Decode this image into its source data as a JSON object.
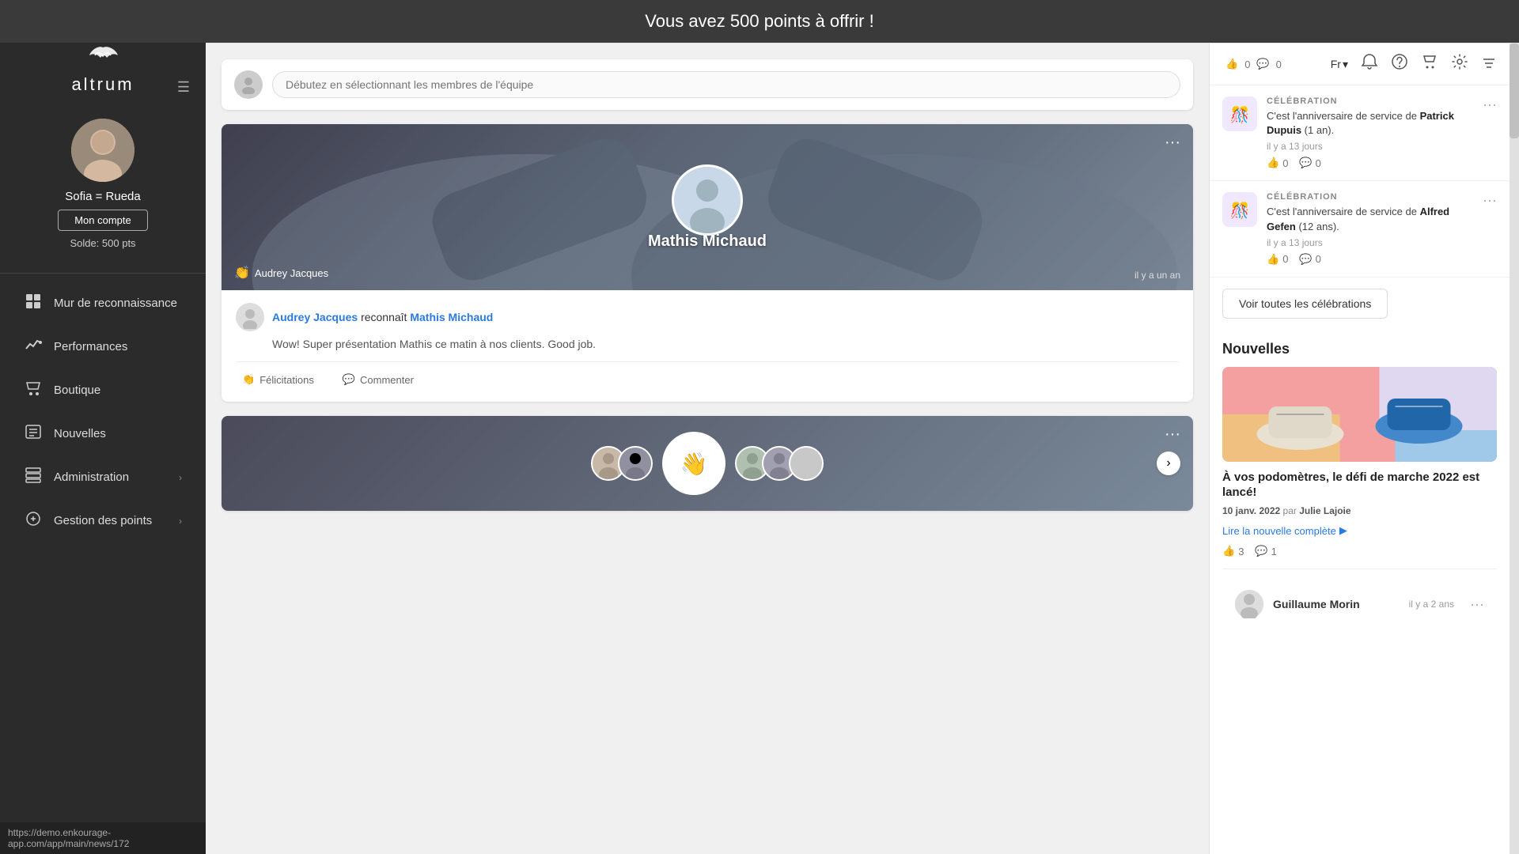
{
  "banner": {
    "text": "Vous avez 500 points à offrir !"
  },
  "sidebar": {
    "logo": {
      "bird": "≋",
      "name": "altrum"
    },
    "user": {
      "name": "Sofia = Rueda",
      "account_btn": "Mon compte",
      "balance": "Solde: 500 pts",
      "avatar_emoji": "👩"
    },
    "nav_items": [
      {
        "id": "mur",
        "label": "Mur de reconnaissance",
        "icon": "🏠"
      },
      {
        "id": "performances",
        "label": "Performances",
        "icon": "📈"
      },
      {
        "id": "boutique",
        "label": "Boutique",
        "icon": "🛍"
      },
      {
        "id": "nouvelles",
        "label": "Nouvelles",
        "icon": "📋"
      },
      {
        "id": "administration",
        "label": "Administration",
        "icon": "🗂",
        "arrow": "›"
      },
      {
        "id": "gestion",
        "label": "Gestion des points",
        "icon": "💰",
        "arrow": "›"
      }
    ]
  },
  "header": {
    "lang": "Fr",
    "lang_arrow": "▾",
    "icons": [
      "bell",
      "question",
      "shop",
      "gear"
    ]
  },
  "team_selector": {
    "placeholder": "Débutez en sélectionnant les membres de l'équipe"
  },
  "post1": {
    "dots": "···",
    "person_name": "Mathis Michaud",
    "sender": "Audrey Jacques",
    "time": "il y a un an",
    "author": "Audrey Jacques",
    "recognizes": "reconnaît",
    "target": "Mathis Michaud",
    "message": "Wow! Super présentation Mathis ce matin à nos clients. Good job.",
    "action_clap": "Félicitations",
    "action_comment": "Commenter"
  },
  "post2": {
    "dots": "···",
    "avatars": [
      "👩",
      "👨",
      "👩",
      "👨",
      "👩"
    ]
  },
  "celebrations": [
    {
      "tag": "CÉLÉBRATION",
      "icon": "🎊",
      "text_pre": "C'est l'anniversaire de service de ",
      "person": "Patrick Dupuis",
      "text_post": " (1 an).",
      "time": "il y a 13 jours",
      "likes": "0",
      "comments": "0"
    },
    {
      "tag": "CÉLÉBRATION",
      "icon": "🎊",
      "text_pre": "C'est l'anniversaire de service de ",
      "person": "Alfred Gefen",
      "text_post": " (12 ans).",
      "time": "il y a 13 jours",
      "likes": "0",
      "comments": "0"
    }
  ],
  "celebrations_btn": "Voir toutes les célébrations",
  "nouvelles": {
    "title": "Nouvelles",
    "news_title": "À vos podomètres, le défi de marche 2022 est lancé!",
    "news_date": "10 janv. 2022",
    "news_author": "Julie Lajoie",
    "read_more": "Lire la nouvelle complète",
    "likes": "3",
    "comments": "1"
  },
  "bottom_user": {
    "name": "Guillaume Morin",
    "time": "il y a 2 ans",
    "dots": "···"
  },
  "url_bar": {
    "url": "https://demo.enkourage-app.com/app/main/news/172"
  }
}
